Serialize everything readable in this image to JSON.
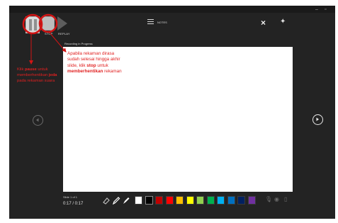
{
  "toolbar": {
    "stop_label": "STOP",
    "replay_label": "REPLAY",
    "notes_label": "NOTES",
    "close_glyph": "×"
  },
  "status": {
    "recording": "Recording in Progress"
  },
  "slide_note": {
    "line1": "Apabila rekaman dirasa",
    "line2": "sudah selesai hingga akhir",
    "line3_pre": "slide, klik ",
    "line3_bold": "stop",
    "line3_post": " untuk",
    "line4_bold": "memberhentikan",
    "line4_post": " rekaman"
  },
  "left_note": {
    "pre": "Klik ",
    "bold1": "pause",
    "mid": " untuk memberhentikan ",
    "bold2": "jeda",
    "post": " pada rekaman suara"
  },
  "bottom": {
    "slide_count": "Slide 1 of 1",
    "time": "0:17 / 0:17"
  },
  "palette": [
    "#ffffff",
    "#000000",
    "#c00000",
    "#ff0000",
    "#ffc000",
    "#ffff00",
    "#92d050",
    "#00b050",
    "#00b0f0",
    "#0070c0",
    "#002060",
    "#7030a0"
  ],
  "annotation_color": "#d21414"
}
